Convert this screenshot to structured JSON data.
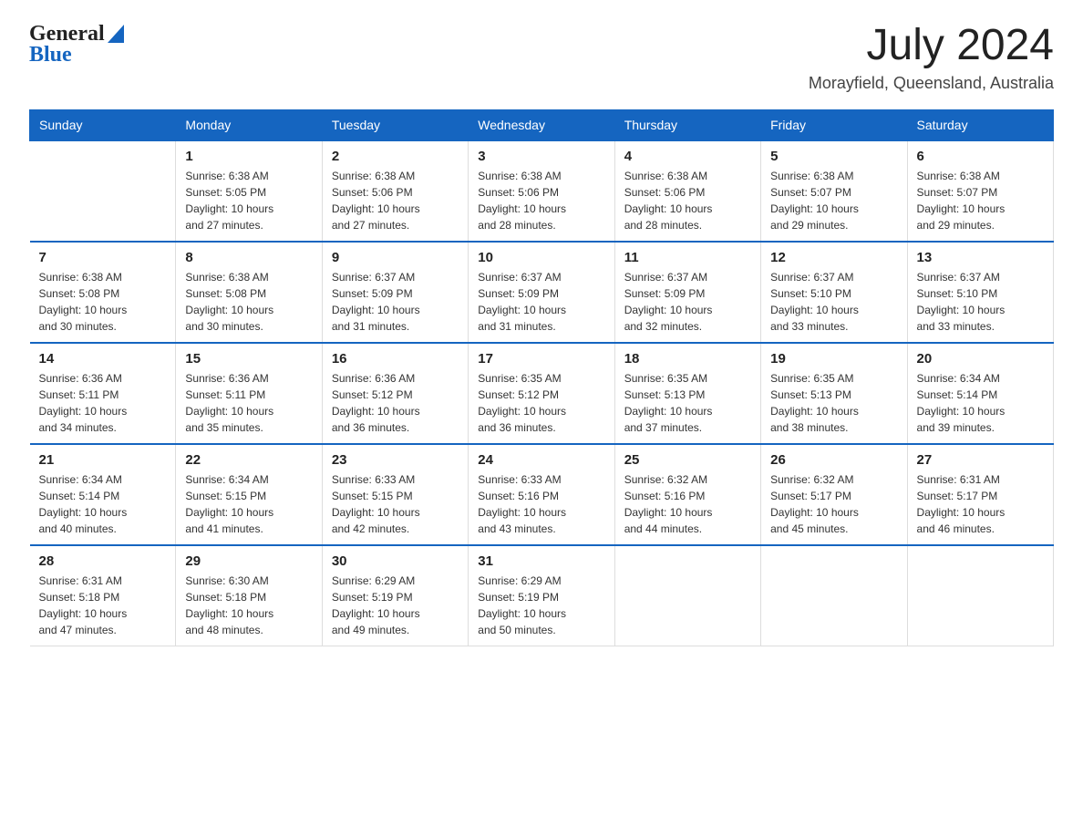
{
  "header": {
    "logo": {
      "general": "General",
      "blue": "Blue"
    },
    "title": "July 2024",
    "location": "Morayfield, Queensland, Australia"
  },
  "calendar": {
    "days_of_week": [
      "Sunday",
      "Monday",
      "Tuesday",
      "Wednesday",
      "Thursday",
      "Friday",
      "Saturday"
    ],
    "weeks": [
      [
        {
          "day": "",
          "info": ""
        },
        {
          "day": "1",
          "info": "Sunrise: 6:38 AM\nSunset: 5:05 PM\nDaylight: 10 hours\nand 27 minutes."
        },
        {
          "day": "2",
          "info": "Sunrise: 6:38 AM\nSunset: 5:06 PM\nDaylight: 10 hours\nand 27 minutes."
        },
        {
          "day": "3",
          "info": "Sunrise: 6:38 AM\nSunset: 5:06 PM\nDaylight: 10 hours\nand 28 minutes."
        },
        {
          "day": "4",
          "info": "Sunrise: 6:38 AM\nSunset: 5:06 PM\nDaylight: 10 hours\nand 28 minutes."
        },
        {
          "day": "5",
          "info": "Sunrise: 6:38 AM\nSunset: 5:07 PM\nDaylight: 10 hours\nand 29 minutes."
        },
        {
          "day": "6",
          "info": "Sunrise: 6:38 AM\nSunset: 5:07 PM\nDaylight: 10 hours\nand 29 minutes."
        }
      ],
      [
        {
          "day": "7",
          "info": "Sunrise: 6:38 AM\nSunset: 5:08 PM\nDaylight: 10 hours\nand 30 minutes."
        },
        {
          "day": "8",
          "info": "Sunrise: 6:38 AM\nSunset: 5:08 PM\nDaylight: 10 hours\nand 30 minutes."
        },
        {
          "day": "9",
          "info": "Sunrise: 6:37 AM\nSunset: 5:09 PM\nDaylight: 10 hours\nand 31 minutes."
        },
        {
          "day": "10",
          "info": "Sunrise: 6:37 AM\nSunset: 5:09 PM\nDaylight: 10 hours\nand 31 minutes."
        },
        {
          "day": "11",
          "info": "Sunrise: 6:37 AM\nSunset: 5:09 PM\nDaylight: 10 hours\nand 32 minutes."
        },
        {
          "day": "12",
          "info": "Sunrise: 6:37 AM\nSunset: 5:10 PM\nDaylight: 10 hours\nand 33 minutes."
        },
        {
          "day": "13",
          "info": "Sunrise: 6:37 AM\nSunset: 5:10 PM\nDaylight: 10 hours\nand 33 minutes."
        }
      ],
      [
        {
          "day": "14",
          "info": "Sunrise: 6:36 AM\nSunset: 5:11 PM\nDaylight: 10 hours\nand 34 minutes."
        },
        {
          "day": "15",
          "info": "Sunrise: 6:36 AM\nSunset: 5:11 PM\nDaylight: 10 hours\nand 35 minutes."
        },
        {
          "day": "16",
          "info": "Sunrise: 6:36 AM\nSunset: 5:12 PM\nDaylight: 10 hours\nand 36 minutes."
        },
        {
          "day": "17",
          "info": "Sunrise: 6:35 AM\nSunset: 5:12 PM\nDaylight: 10 hours\nand 36 minutes."
        },
        {
          "day": "18",
          "info": "Sunrise: 6:35 AM\nSunset: 5:13 PM\nDaylight: 10 hours\nand 37 minutes."
        },
        {
          "day": "19",
          "info": "Sunrise: 6:35 AM\nSunset: 5:13 PM\nDaylight: 10 hours\nand 38 minutes."
        },
        {
          "day": "20",
          "info": "Sunrise: 6:34 AM\nSunset: 5:14 PM\nDaylight: 10 hours\nand 39 minutes."
        }
      ],
      [
        {
          "day": "21",
          "info": "Sunrise: 6:34 AM\nSunset: 5:14 PM\nDaylight: 10 hours\nand 40 minutes."
        },
        {
          "day": "22",
          "info": "Sunrise: 6:34 AM\nSunset: 5:15 PM\nDaylight: 10 hours\nand 41 minutes."
        },
        {
          "day": "23",
          "info": "Sunrise: 6:33 AM\nSunset: 5:15 PM\nDaylight: 10 hours\nand 42 minutes."
        },
        {
          "day": "24",
          "info": "Sunrise: 6:33 AM\nSunset: 5:16 PM\nDaylight: 10 hours\nand 43 minutes."
        },
        {
          "day": "25",
          "info": "Sunrise: 6:32 AM\nSunset: 5:16 PM\nDaylight: 10 hours\nand 44 minutes."
        },
        {
          "day": "26",
          "info": "Sunrise: 6:32 AM\nSunset: 5:17 PM\nDaylight: 10 hours\nand 45 minutes."
        },
        {
          "day": "27",
          "info": "Sunrise: 6:31 AM\nSunset: 5:17 PM\nDaylight: 10 hours\nand 46 minutes."
        }
      ],
      [
        {
          "day": "28",
          "info": "Sunrise: 6:31 AM\nSunset: 5:18 PM\nDaylight: 10 hours\nand 47 minutes."
        },
        {
          "day": "29",
          "info": "Sunrise: 6:30 AM\nSunset: 5:18 PM\nDaylight: 10 hours\nand 48 minutes."
        },
        {
          "day": "30",
          "info": "Sunrise: 6:29 AM\nSunset: 5:19 PM\nDaylight: 10 hours\nand 49 minutes."
        },
        {
          "day": "31",
          "info": "Sunrise: 6:29 AM\nSunset: 5:19 PM\nDaylight: 10 hours\nand 50 minutes."
        },
        {
          "day": "",
          "info": ""
        },
        {
          "day": "",
          "info": ""
        },
        {
          "day": "",
          "info": ""
        }
      ]
    ]
  }
}
